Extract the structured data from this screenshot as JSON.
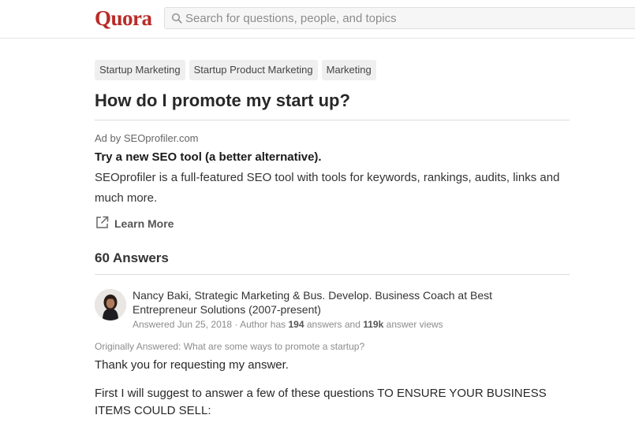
{
  "header": {
    "logo": "Quora",
    "search_placeholder": "Search for questions, people, and topics"
  },
  "question": {
    "topics": [
      "Startup Marketing",
      "Startup Product Marketing",
      "Marketing"
    ],
    "title": "How do I promote my start up?"
  },
  "ad": {
    "by": "Ad by SEOprofiler.com",
    "headline": "Try a new SEO tool (a better alternative).",
    "body": "SEOprofiler is a full-featured SEO tool with tools for keywords, rankings, audits, links and much more.",
    "learn_more": "Learn More"
  },
  "answers": {
    "count_label": "60 Answers",
    "first": {
      "author_credential": "Nancy Baki, Strategic Marketing & Bus. Develop. Business Coach at Best Entrepreneur Solutions (2007-present)",
      "answered": "Answered Jun 25, 2018 · Author has",
      "answers_count": "194",
      "answers_word": "answers and",
      "views_count": "119k",
      "views_word": "answer views",
      "originally_answered": "Originally Answered: What are some ways to promote a startup?",
      "paragraphs": [
        "Thank you for requesting my answer.",
        "First I will suggest to answer a few of these questions TO ENSURE YOUR BUSINESS ITEMS COULD SELL:"
      ]
    }
  },
  "icons": {
    "search": "search-icon",
    "external_link": "external-link-icon"
  },
  "colors": {
    "brand": "#b92b27",
    "topic_bg": "#efefef",
    "muted_text": "#8c8c8c"
  }
}
